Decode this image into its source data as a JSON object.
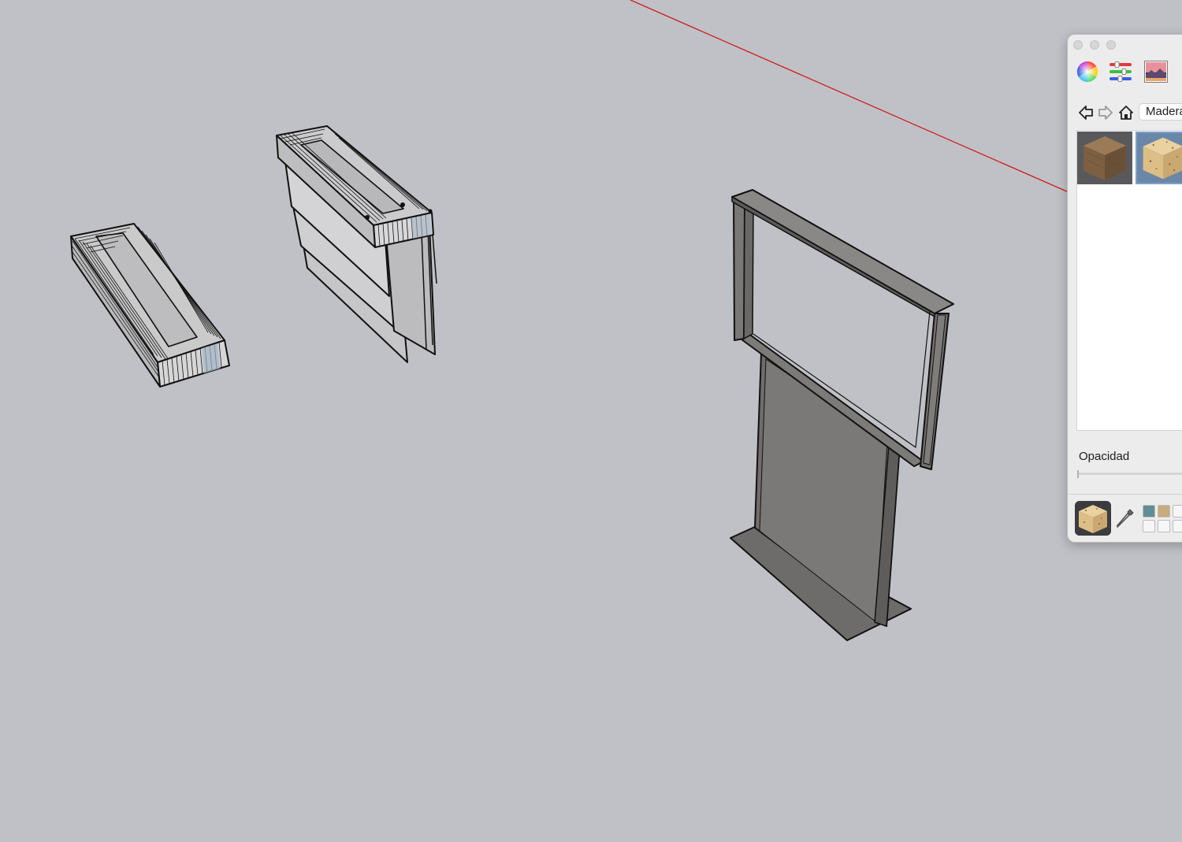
{
  "colors": {
    "background": "#c0c1c6",
    "red_axis": "#cc1f1f",
    "outline": "#111111",
    "face": "#c9c9c9",
    "textured_face": "#7a7876",
    "swatch_teal": "#5f8e94",
    "swatch_tan": "#c7ad7c"
  },
  "icons": {
    "color_wheel_tab": "color-wheel-icon",
    "sliders_tab": "sliders-icon",
    "image_tab": "image-palette-icon",
    "back": "back-arrow-icon",
    "forward": "forward-arrow-icon",
    "home": "home-icon",
    "eyedropper": "eyedropper-icon"
  },
  "materials_panel": {
    "collection": "Madera",
    "opacity_label": "Opacidad",
    "opacity_value": 0
  }
}
